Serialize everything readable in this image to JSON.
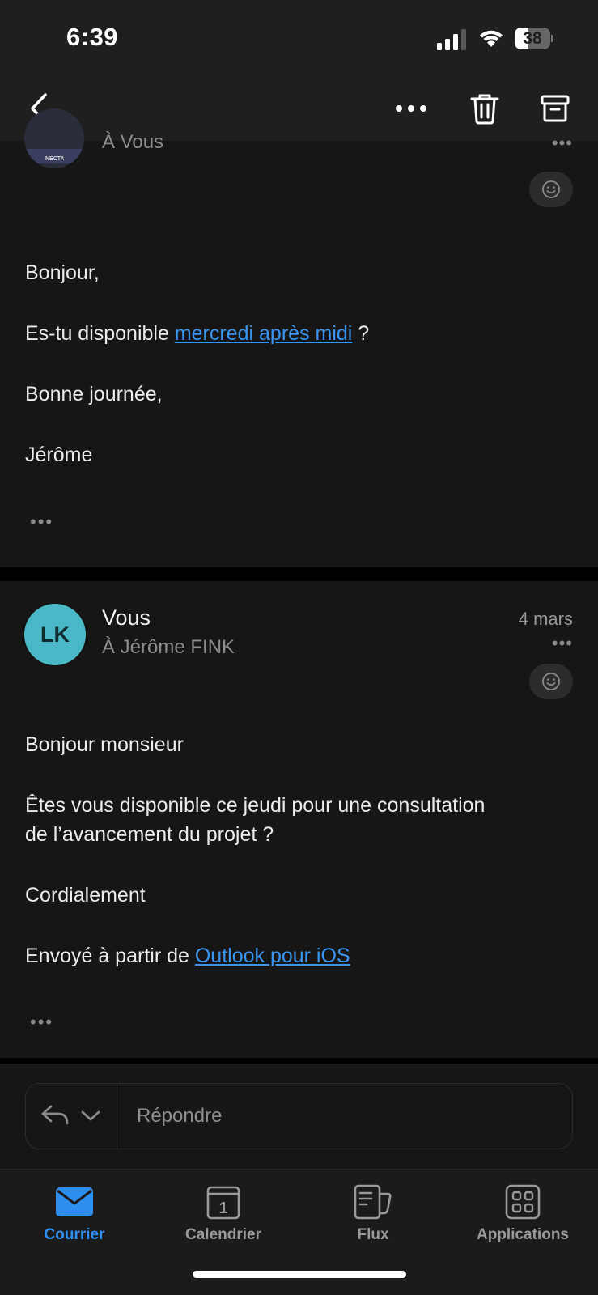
{
  "status_bar": {
    "time": "6:39",
    "battery": "38",
    "battery_level": 0.38
  },
  "nav": {
    "back_icon": "chevron-left-icon",
    "more_icon": "ellipsis-icon",
    "delete_icon": "trash-icon",
    "archive_icon": "archive-icon"
  },
  "message1": {
    "to": "À Vous",
    "more": "•••",
    "greeting": "Bonjour,",
    "line_pre": "Es-tu disponible ",
    "line_link": "mercredi après midi",
    "line_post": " ?",
    "closing": "Bonne journée,",
    "signature": "Jérôme",
    "expand": "•••"
  },
  "message2": {
    "avatar_initials": "LK",
    "sender": "Vous",
    "to": "À Jérôme FINK",
    "date": "4 mars",
    "more": "•••",
    "greeting": "Bonjour monsieur",
    "line1": "Êtes vous disponible ce jeudi pour une consultation",
    "line2": "de l’avancement du projet ?",
    "closing": "Cordialement",
    "sent_pre": "Envoyé à partir de ",
    "sent_link": "Outlook pour iOS",
    "expand": "•••"
  },
  "reply": {
    "placeholder": "Répondre"
  },
  "tabs": [
    {
      "label": "Courrier",
      "icon": "mail-icon",
      "active": true
    },
    {
      "label": "Calendrier",
      "icon": "calendar-icon",
      "active": false,
      "calendar_day": "1"
    },
    {
      "label": "Flux",
      "icon": "feed-icon",
      "active": false
    },
    {
      "label": "Applications",
      "icon": "apps-icon",
      "active": false
    }
  ],
  "colors": {
    "accent": "#2e8ef0",
    "link": "#3a95f0",
    "avatar": "#4ab8c6",
    "background": "#161616"
  }
}
